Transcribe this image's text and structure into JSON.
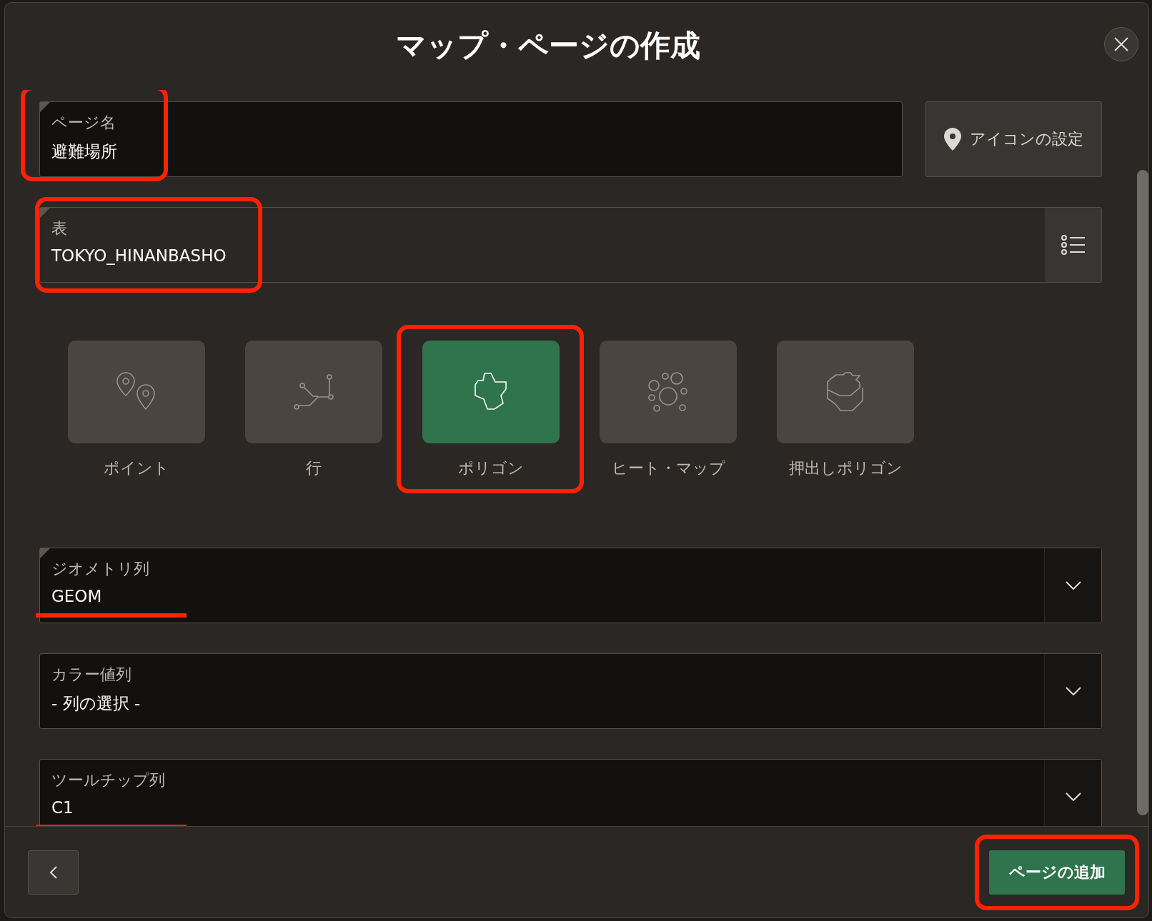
{
  "dialog": {
    "title": "マップ・ページの作成"
  },
  "page_name": {
    "label": "ページ名",
    "value": "避難場所",
    "required": true,
    "boxed": true
  },
  "icon_button": {
    "label": "アイコンの設定"
  },
  "table": {
    "label": "表",
    "value": "TOKYO_HINANBASHO",
    "required": true,
    "boxed": true
  },
  "map_types": [
    {
      "kind": "point",
      "label": "ポイント",
      "selected": false,
      "boxed": false
    },
    {
      "kind": "line",
      "label": "行",
      "selected": false,
      "boxed": false
    },
    {
      "kind": "polygon",
      "label": "ポリゴン",
      "selected": true,
      "boxed": true
    },
    {
      "kind": "heatmap",
      "label": "ヒート・マップ",
      "selected": false,
      "boxed": false
    },
    {
      "kind": "extruded",
      "label": "押出しポリゴン",
      "selected": false,
      "boxed": false
    }
  ],
  "selects": [
    {
      "label": "ジオメトリ列",
      "value": "GEOM",
      "required": true,
      "underlined": true
    },
    {
      "label": "カラー値列",
      "value": "- 列の選択 -",
      "required": false,
      "underlined": false
    },
    {
      "label": "ツールチップ列",
      "value": "C1",
      "required": false,
      "underlined": true
    }
  ],
  "footer": {
    "add_button": {
      "label": "ページの追加",
      "boxed": true
    }
  }
}
